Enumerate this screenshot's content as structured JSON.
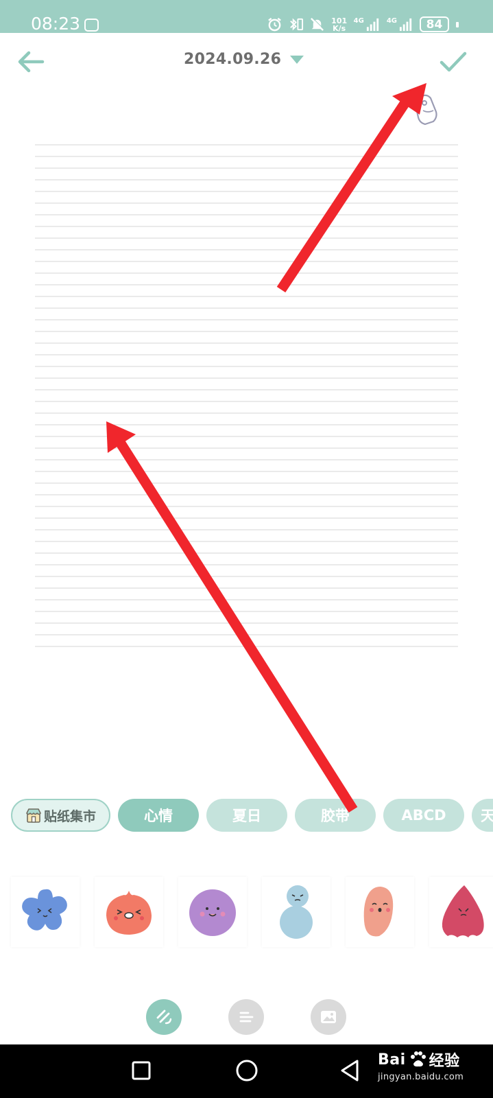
{
  "status_bar": {
    "time": "08:23",
    "net_speed_top": "101",
    "net_speed_unit": "K/s",
    "signal_1": "4G",
    "signal_2": "4G",
    "battery": "84",
    "icons": [
      "chat-bubble-icon",
      "alarm-icon",
      "bluetooth-icon",
      "vibrate-icon",
      "mute-icon",
      "signal-icon",
      "signal-icon",
      "battery-icon"
    ],
    "color": "#9dcfc3"
  },
  "header": {
    "title": "2024.09.26",
    "back_icon": "back-arrow-icon",
    "confirm_icon": "check-icon",
    "dropdown_icon": "caret-down-icon",
    "accent": "#8fcabc"
  },
  "sticker_tabs": {
    "market_label": "贴纸集市",
    "items": [
      "心情",
      "夏日",
      "胶带",
      "ABCD",
      "天"
    ],
    "active_index": 0
  },
  "stickers": [
    "blue-flower-sticker",
    "red-blob-sticker",
    "purple-circle-sticker",
    "blue-gourd-sticker",
    "pink-bean-sticker",
    "crimson-drop-sticker"
  ],
  "toolbar": [
    "sticker-tool-icon",
    "text-align-icon",
    "image-icon"
  ],
  "annotation": {
    "arrow_color": "#f0262c"
  },
  "nav_bar": {
    "watermark_logo": "Bai",
    "watermark_logo_tail": "经验",
    "watermark_url": "jingyan.baidu.com"
  }
}
